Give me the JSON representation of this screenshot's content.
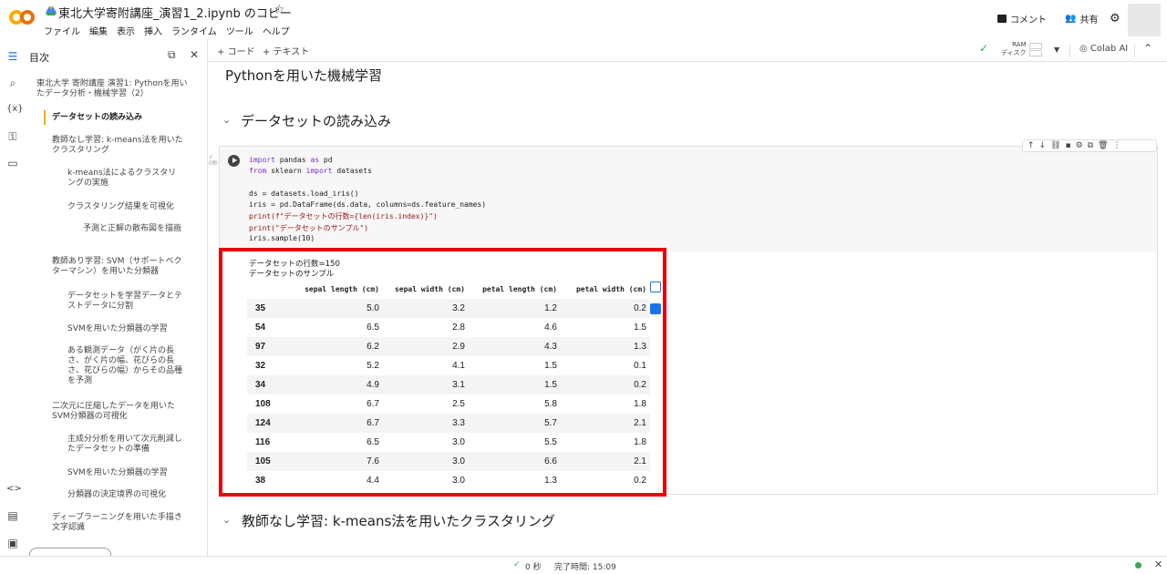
{
  "app": {
    "title": "東北大学寄附講座_演習1_2.ipynb のコピー",
    "menus": [
      "ファイル",
      "編集",
      "表示",
      "挿入",
      "ランタイム",
      "ツール",
      "ヘルプ"
    ],
    "comment_label": "コメント",
    "share_label": "共有",
    "accent": "#f9ab00"
  },
  "toolbar": {
    "add_code": "+ コード",
    "add_text": "+ テキスト",
    "ram_label": "RAM",
    "disk_label": "ディスク",
    "colab_ai": "Colab AI"
  },
  "sidebar": {
    "heading": "目次",
    "items": [
      {
        "text": "東北大学 寄附講座 演習1: Pythonを用いたデータ分析・機械学習（2）",
        "level": 0
      },
      {
        "text": "データセットの読み込み",
        "level": 1,
        "active": true
      },
      {
        "text": "教師なし学習: k-means法を用いたクラスタリング",
        "level": 1
      },
      {
        "text": "k-means法によるクラスタリングの実施",
        "level": 2
      },
      {
        "text": "クラスタリング結果を可視化",
        "level": 2
      },
      {
        "text": "予測と正解の散布図を描画",
        "level": 3
      },
      {
        "text": "教師あり学習: SVM（サポートベクターマシン）を用いた分類器",
        "level": 1
      },
      {
        "text": "データセットを学習データとテストデータに分割",
        "level": 2
      },
      {
        "text": "SVMを用いた分類器の学習",
        "level": 2
      },
      {
        "text": "ある観測データ（がく片の長さ、がく片の幅、花びらの長さ、花びらの幅）からその品種を予測",
        "level": 2
      },
      {
        "text": "二次元に圧縮したデータを用いたSVM分類器の可視化",
        "level": 1
      },
      {
        "text": "主成分分析を用いて次元削減したデータセットの準備",
        "level": 2
      },
      {
        "text": "SVMを用いた分類器の学習",
        "level": 2
      },
      {
        "text": "分類器の決定境界の可視化",
        "level": 2
      },
      {
        "text": "ディープラーニングを用いた手描き文字認識",
        "level": 1
      }
    ]
  },
  "notebook": {
    "heading_top": "Pythonを用いた機械学習",
    "section1": "データセットの読み込み",
    "section2": "教師なし学習: k-means法を用いたクラスタリング",
    "exec_time": "0秒",
    "code_lines": [
      "import pandas as pd",
      "from sklearn import datasets",
      "",
      "ds = datasets.load_iris()",
      "iris = pd.DataFrame(ds.data, columns=ds.feature_names)",
      "print(f\"データセットの行数={len(iris.index)}\")",
      "print(\"データセットのサンプル\")",
      "iris.sample(10)"
    ],
    "output_lines": [
      "データセットの行数=150",
      "データセットのサンプル"
    ],
    "table": {
      "columns": [
        "sepal length (cm)",
        "sepal width (cm)",
        "petal length (cm)",
        "petal width (cm)"
      ],
      "rows": [
        {
          "index": "35",
          "values": [
            "5.0",
            "3.2",
            "1.2",
            "0.2"
          ]
        },
        {
          "index": "54",
          "values": [
            "6.5",
            "2.8",
            "4.6",
            "1.5"
          ]
        },
        {
          "index": "97",
          "values": [
            "6.2",
            "2.9",
            "4.3",
            "1.3"
          ]
        },
        {
          "index": "32",
          "values": [
            "5.2",
            "4.1",
            "1.5",
            "0.1"
          ]
        },
        {
          "index": "34",
          "values": [
            "4.9",
            "3.1",
            "1.5",
            "0.2"
          ]
        },
        {
          "index": "108",
          "values": [
            "6.7",
            "2.5",
            "5.8",
            "1.8"
          ]
        },
        {
          "index": "124",
          "values": [
            "6.7",
            "3.3",
            "5.7",
            "2.1"
          ]
        },
        {
          "index": "116",
          "values": [
            "6.5",
            "3.0",
            "5.5",
            "1.8"
          ]
        },
        {
          "index": "105",
          "values": [
            "7.6",
            "3.0",
            "6.6",
            "2.1"
          ]
        },
        {
          "index": "38",
          "values": [
            "4.4",
            "3.0",
            "1.3",
            "0.2"
          ]
        }
      ]
    }
  },
  "status": {
    "elapsed": "0 秒",
    "completed": "完了時間: 15:09"
  }
}
